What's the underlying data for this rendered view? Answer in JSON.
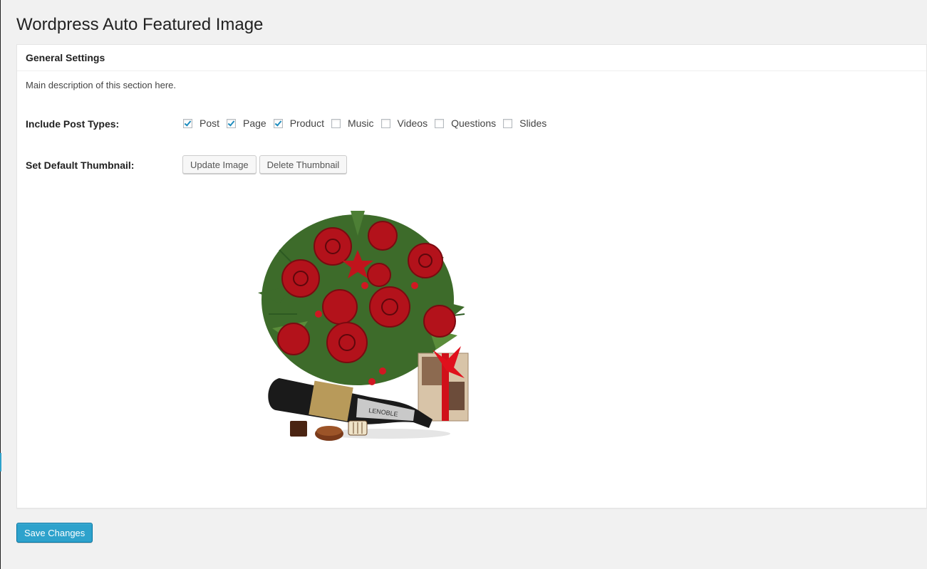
{
  "page": {
    "title": "Wordpress Auto Featured Image"
  },
  "section": {
    "heading": "General Settings",
    "description": "Main description of this section here."
  },
  "post_types": {
    "label": "Include Post Types:",
    "options": [
      {
        "label": "Post",
        "checked": true
      },
      {
        "label": "Page",
        "checked": true
      },
      {
        "label": "Product",
        "checked": true
      },
      {
        "label": "Music",
        "checked": false
      },
      {
        "label": "Videos",
        "checked": false
      },
      {
        "label": "Questions",
        "checked": false
      },
      {
        "label": "Slides",
        "checked": false
      }
    ]
  },
  "thumbnail": {
    "label": "Set Default Thumbnail:",
    "update_label": "Update Image",
    "delete_label": "Delete Thumbnail",
    "image_icon": "bouquet-image"
  },
  "actions": {
    "save_label": "Save Changes"
  },
  "colors": {
    "accent": "#2ea2cc",
    "checkmark": "#1e8cbe",
    "background": "#f1f1f1"
  }
}
